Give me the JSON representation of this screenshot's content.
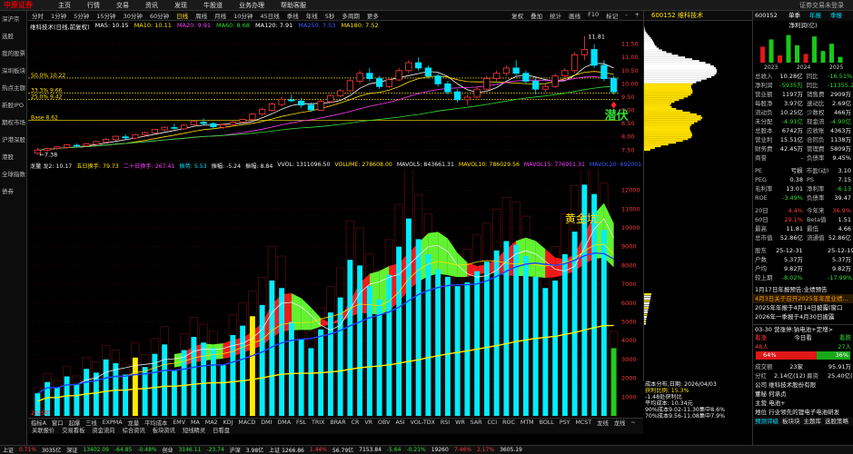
{
  "menubar": {
    "logo": "中原证券",
    "items": [
      "主页",
      "行情",
      "交易",
      "资讯",
      "发现",
      "牛股道",
      "业务办理",
      "帮助客服"
    ],
    "right_text": "证券交易未登录"
  },
  "sidebar": {
    "items": [
      "深沪京",
      "选股",
      "我的股票",
      "深圳板块",
      "热点主题",
      "新股IPO",
      "期权市场",
      "沪港深股",
      "港股",
      "全球指数",
      "债券"
    ]
  },
  "periodbar": {
    "items": [
      "分时",
      "1分钟",
      "5分钟",
      "15分钟",
      "30分钟",
      "60分钟",
      "日线",
      "周线",
      "月线",
      "10分钟",
      "45日线",
      "季线",
      "年线",
      "5秒",
      "多周期",
      "更多"
    ],
    "active": "日线",
    "right_items": [
      "复权",
      "叠加",
      "统计",
      "画线",
      "F10",
      "标记",
      "-",
      "+"
    ]
  },
  "stock": {
    "code": "600152",
    "name": "维科技术",
    "title_tag": "600152 维科技术"
  },
  "mainlegend": {
    "name": "维科技术(日线,前复权)",
    "ma": [
      {
        "label": "MA5: 10.15",
        "color": "#ffffff"
      },
      {
        "label": "MA10: 10.11",
        "color": "#ffe000"
      },
      {
        "label": "MA20: 9.91",
        "color": "#ff40ff"
      },
      {
        "label": "MA60: 8.68",
        "color": "#33dd33"
      },
      {
        "label": "MA120: 7.91",
        "color": "#ffffff"
      },
      {
        "label": "MA250: 7.53",
        "color": "#4060ff"
      },
      {
        "label": "MA180: 7.52",
        "color": "#ffe000"
      }
    ]
  },
  "price_levels": [
    {
      "label": "50.0% 10.22",
      "value": 10.22,
      "color": "#ffe000"
    },
    {
      "label": "33.3% 9.66",
      "value": 9.66,
      "color": "#ffe000"
    },
    {
      "label": "25.0% 9.42",
      "value": 9.42,
      "color": "#ffe000"
    },
    {
      "label": "Base 8.62",
      "value": 8.62,
      "color": "#ffe000"
    }
  ],
  "price_axis": [
    "11.50",
    "11.00",
    "10.50",
    "10.00",
    "9.50",
    "9.00",
    "8.50",
    "8.00",
    "7.50"
  ],
  "high_marker": "11.81",
  "low_marker": "7.38",
  "annotation_main": "潜伏",
  "volbar": {
    "items": [
      {
        "label": "龙量 龙2: 10.17",
        "color": "#eeeeee"
      },
      {
        "label": "五日换手: 79.73",
        "color": "#ffe000"
      },
      {
        "label": "二十日换手: 267.41",
        "color": "#ff40ff"
      },
      {
        "label": "振势: 5.53",
        "color": "#00e0ff"
      },
      {
        "label": "振幅: -5.24",
        "color": "#eeeeee"
      },
      {
        "label": "振幅: 8.84",
        "color": "#eeeeee"
      },
      {
        "label": "VVOL: 1311096.50",
        "color": "#eeeeee"
      },
      {
        "label": "VOLUME: 278608.00",
        "color": "#ffe000"
      },
      {
        "label": "MAVOL5: 843661.31",
        "color": "#eeeeee"
      },
      {
        "label": "MAVOL10: 786029.56",
        "color": "#ffe000"
      },
      {
        "label": "MAVOL15: 776951.31",
        "color": "#ff40ff"
      },
      {
        "label": "MAVOL20: 692001.06",
        "color": "#4060ff"
      }
    ]
  },
  "vol_axis": [
    "12000",
    "11000",
    "10000",
    "9000",
    "8000",
    "7000",
    "6000",
    "5000",
    "4000",
    "3000",
    "2000",
    "1000"
  ],
  "annotation_vol": "黄金坑",
  "date_label": "2025年",
  "indicator_tabs": [
    "指标A",
    "窗口",
    "起爆",
    "三线",
    "EXPMA",
    "龙量",
    "平均成本",
    "EMV",
    "MA",
    "MA2",
    "KDJ",
    "MACD",
    "DMI",
    "DMA",
    "FSL",
    "TRIX",
    "BRAR",
    "CR",
    "VR",
    "OBV",
    "ASI",
    "VOL-TDX",
    "RSI",
    "WR",
    "SAR",
    "CCI",
    "ROC",
    "MTM",
    "BOLL",
    "PSY",
    "MCST",
    "龙线",
    "龙线",
    "~"
  ],
  "info_tabs": [
    "关联报价",
    "交易看板",
    "资金流向",
    "综合资讯",
    "板块资讯",
    "短线精灵",
    "日看盘"
  ],
  "statusbar": [
    {
      "label": "上证",
      "color": "#eeeeee"
    },
    {
      "label": "0.71%",
      "color": "#ff3b3b"
    },
    {
      "label": "3035亿",
      "color": "#eeeeee"
    },
    {
      "label": "深证",
      "color": "#eeeeee"
    },
    {
      "label": "13402.09",
      "color": "#33dd33"
    },
    {
      "label": "-64.85",
      "color": "#33dd33"
    },
    {
      "label": "-0.48%",
      "color": "#33dd33"
    },
    {
      "label": "创业",
      "color": "#eeeeee"
    },
    {
      "label": "3146.11",
      "color": "#33dd33"
    },
    {
      "label": "-23.74",
      "color": "#33dd33"
    },
    {
      "label": "沪深",
      "color": "#eeeeee"
    },
    {
      "label": "3.98亿",
      "color": "#eeeeee"
    },
    {
      "label": "上证 1266.86",
      "color": "#eeeeee"
    },
    {
      "label": "1.44%",
      "color": "#ff3b3b"
    },
    {
      "label": "56.79亿",
      "color": "#eeeeee"
    },
    {
      "label": "7153.84",
      "color": "#eeeeee"
    },
    {
      "label": "-5.64",
      "color": "#33dd33"
    },
    {
      "label": "-0.21%",
      "color": "#33dd33"
    },
    {
      "label": "19260",
      "color": "#eeeeee"
    },
    {
      "label": "7:46%",
      "color": "#ff3b3b"
    },
    {
      "label": "2.17%",
      "color": "#ff3b3b"
    },
    {
      "label": "3605.19",
      "color": "#eeeeee"
    }
  ],
  "midtop": {
    "label": "600152 维科技术"
  },
  "rightpanel": {
    "head_code": "600152",
    "head_tabs": [
      "单季",
      "年报",
      "季报"
    ],
    "chart_title": "净利润(亿)",
    "chart_years": [
      "2023",
      "2024",
      "2025"
    ],
    "rows": [
      {
        "k": "总收入",
        "v": "10.28亿",
        "k2": "同比",
        "v2": "-16.51%",
        "c1": "#eeeeee",
        "c2": "#33dd33"
      },
      {
        "k": "净利润",
        "v": "-5935万",
        "k2": "同比",
        "v2": "-11355.24",
        "c1": "#33dd33",
        "c2": "#33dd33"
      },
      {
        "k": "营业额",
        "v": "1197万",
        "k2": "销售费",
        "v2": "2909万",
        "c1": "#eeeeee",
        "c2": "#eeeeee"
      },
      {
        "k": "每股净",
        "v": "3.97亿",
        "k2": "速动比",
        "v2": "2.69亿",
        "c1": "#eeeeee",
        "c2": "#eeeeee"
      },
      {
        "k": "流动负",
        "v": "10.25亿",
        "k2": "少数权",
        "v2": "466万",
        "c1": "#eeeeee",
        "c2": "#eeeeee"
      },
      {
        "k": "未分配",
        "v": "-4.91亿",
        "k2": "现金流",
        "v2": "-4.90亿",
        "c1": "#33dd33",
        "c2": "#33dd33"
      },
      {
        "k": "总股本",
        "v": "6742万",
        "k2": "应收账",
        "v2": "4363万",
        "c1": "#eeeeee",
        "c2": "#eeeeee"
      },
      {
        "k": "营业利",
        "v": "15.51亿",
        "k2": "合同负",
        "v2": "1138万",
        "c1": "#eeeeee",
        "c2": "#eeeeee"
      },
      {
        "k": "财务费",
        "v": "42.45万",
        "k2": "管理费",
        "v2": "5809万",
        "c1": "#eeeeee",
        "c2": "#eeeeee"
      },
      {
        "k": "商誉",
        "v": "-",
        "k2": "负债率",
        "v2": "9.45%",
        "c1": "#eeeeee",
        "c2": "#eeeeee"
      }
    ],
    "rows2": [
      {
        "k": "PE",
        "v": "亏损",
        "k2": "市盈(动)",
        "v2": "3.10",
        "c1": "#eeeeee",
        "c2": "#eeeeee"
      },
      {
        "k": "PEG",
        "v": "0.38",
        "k2": "PS",
        "v2": "7.15",
        "c1": "#eeeeee",
        "c2": "#eeeeee"
      },
      {
        "k": "毛利率",
        "v": "13.01",
        "k2": "净利率",
        "v2": "-6.13",
        "c1": "#eeeeee",
        "c2": "#33dd33"
      },
      {
        "k": "ROE",
        "v": "-3.49%",
        "k2": "负债率",
        "v2": "39.47",
        "c1": "#33dd33",
        "c2": "#eeeeee"
      }
    ],
    "rows3": [
      {
        "k": "20日",
        "v": "4.4%",
        "k2": "今年来",
        "v2": "36.9%",
        "c1": "#ff3b3b",
        "c2": "#ff3b3b"
      },
      {
        "k": "60日",
        "v": "29.1%",
        "k2": "Beta值",
        "v2": "1.51",
        "c1": "#ff3b3b",
        "c2": "#eeeeee"
      },
      {
        "k": "最高",
        "v": "11.81",
        "k2": "最低",
        "v2": "4.66",
        "c1": "#eeeeee",
        "c2": "#eeeeee"
      },
      {
        "k": "总市值",
        "v": "52.86亿",
        "k2": "流通值",
        "v2": "52.86亿",
        "c1": "#eeeeee",
        "c2": "#eeeeee"
      }
    ],
    "rows4": [
      {
        "k": "股东",
        "v": "25-12-31",
        "k2": "",
        "v2": "25-12-19",
        "c1": "#eeeeee",
        "c2": "#eeeeee"
      },
      {
        "k": "户数",
        "v": "5.37万",
        "k2": "",
        "v2": "5.37万",
        "c1": "#eeeeee",
        "c2": "#eeeeee"
      },
      {
        "k": "户均",
        "v": "9.82万",
        "k2": "",
        "v2": "9.82万",
        "c1": "#eeeeee",
        "c2": "#eeeeee"
      },
      {
        "k": "较上期",
        "v": "-8.02%",
        "k2": "",
        "v2": "-17.99%",
        "c1": "#33dd33",
        "c2": "#33dd33"
      }
    ],
    "news": [
      {
        "t": "1月17日年报预告:业绩预告",
        "c": "#eeeeee"
      },
      {
        "t": "4月3日关于召开2025年年度业绩...",
        "c": "#ff9a00"
      },
      {
        "t": "2025年年报于4月14日披露(窗口",
        "c": "#eeeeee"
      },
      {
        "t": "2026年一季报于4月30日披露",
        "c": "#eeeeee"
      }
    ],
    "notice": "03-30 营涨停:钠电池+定增>",
    "vote": {
      "label": "看涨",
      "mid": "今日看",
      "right": "看跌",
      "left_n": "48人",
      "right_n": "27人",
      "left_pct": "64%",
      "right_pct": "36%",
      "left_ratio": 0.64
    },
    "bottom_rows": [
      {
        "k": "成交额",
        "v": "23家",
        "k2": "",
        "v2": "95.91万",
        "c1": "#eeeeee",
        "c2": "#eeeeee"
      },
      {
        "k": "分红",
        "v": "2.14亿(12)",
        "k2": "募资",
        "v2": "25.40亿(12)",
        "c1": "#eeeeee",
        "c2": "#eeeeee"
      }
    ],
    "company": [
      {
        "t": "公司  维科技术股份有限",
        "c": "#eeeeee"
      },
      {
        "t": "董秘  何承贞",
        "c": "#eeeeee"
      },
      {
        "t": "主营  电池+",
        "c": "#eeeeee"
      },
      {
        "t": "地位  行业领先的锂电子电池研发",
        "c": "#eeeeee"
      }
    ],
    "bottom_tabs": [
      "预测评级",
      "板块块",
      "主题库",
      "选股策略"
    ]
  },
  "costinfo": {
    "lines": [
      "成本分布,日期: 2026/04/03",
      "获利比例:   15.3%",
      "-1.48处获利比",
      "平均成本: 10.34元",
      "90%成本9.02-11.30集中8.6%",
      "70%成本9.56-11.08集中7.9%"
    ]
  },
  "chart_data": {
    "type": "candlestick",
    "candles": [
      [
        7.38,
        7.58,
        7.32,
        7.5
      ],
      [
        7.5,
        7.6,
        7.42,
        7.56
      ],
      [
        7.56,
        7.65,
        7.5,
        7.62
      ],
      [
        7.6,
        7.72,
        7.55,
        7.7
      ],
      [
        7.68,
        7.75,
        7.6,
        7.66
      ],
      [
        7.66,
        7.78,
        7.62,
        7.74
      ],
      [
        7.72,
        7.85,
        7.68,
        7.82
      ],
      [
        7.8,
        7.95,
        7.76,
        7.9
      ],
      [
        7.9,
        8.05,
        7.85,
        8.02
      ],
      [
        8.0,
        8.1,
        7.9,
        7.96
      ],
      [
        7.95,
        8.12,
        7.9,
        8.08
      ],
      [
        8.08,
        8.2,
        8.02,
        8.16
      ],
      [
        8.15,
        8.3,
        8.1,
        8.28
      ],
      [
        8.26,
        8.4,
        8.2,
        8.36
      ],
      [
        8.35,
        8.5,
        8.28,
        8.32
      ],
      [
        8.3,
        8.48,
        8.26,
        8.44
      ],
      [
        8.45,
        8.62,
        8.4,
        8.58
      ],
      [
        8.55,
        8.7,
        8.45,
        8.5
      ],
      [
        8.5,
        8.55,
        8.3,
        8.38
      ],
      [
        8.36,
        8.5,
        8.3,
        8.46
      ],
      [
        8.46,
        8.6,
        8.4,
        8.56
      ],
      [
        8.55,
        8.7,
        8.5,
        8.66
      ],
      [
        8.65,
        8.9,
        8.6,
        8.86
      ],
      [
        8.86,
        9.1,
        8.8,
        9.04
      ],
      [
        9.0,
        9.3,
        8.96,
        9.24
      ],
      [
        9.22,
        9.5,
        9.15,
        9.42
      ],
      [
        9.4,
        9.6,
        9.3,
        9.36
      ],
      [
        9.35,
        9.45,
        9.1,
        9.2
      ],
      [
        9.2,
        9.3,
        8.95,
        9.02
      ],
      [
        9.0,
        9.4,
        8.98,
        9.34
      ],
      [
        9.32,
        9.6,
        9.3,
        9.56
      ],
      [
        9.55,
        9.8,
        9.5,
        9.74
      ],
      [
        9.74,
        10.2,
        9.7,
        10.12
      ],
      [
        10.1,
        10.5,
        10.0,
        10.4
      ],
      [
        10.4,
        10.6,
        10.1,
        10.2
      ],
      [
        10.2,
        10.3,
        9.8,
        9.9
      ],
      [
        9.9,
        10.2,
        9.85,
        10.16
      ],
      [
        10.15,
        10.6,
        10.1,
        10.5
      ],
      [
        10.5,
        10.9,
        10.4,
        10.8
      ],
      [
        10.8,
        11.0,
        10.5,
        10.6
      ],
      [
        10.6,
        10.7,
        10.2,
        10.3
      ],
      [
        10.3,
        10.4,
        9.9,
        10.0
      ],
      [
        10.0,
        10.1,
        9.6,
        9.7
      ],
      [
        9.7,
        9.8,
        9.3,
        9.4
      ],
      [
        9.4,
        9.6,
        9.2,
        9.5
      ],
      [
        9.5,
        9.9,
        9.45,
        9.8
      ],
      [
        9.8,
        10.3,
        9.75,
        10.2
      ],
      [
        10.2,
        10.5,
        10.1,
        10.4
      ],
      [
        10.4,
        10.7,
        10.3,
        10.6
      ],
      [
        10.6,
        10.9,
        10.3,
        10.4
      ],
      [
        10.4,
        10.5,
        10.0,
        10.1
      ],
      [
        10.1,
        10.2,
        9.6,
        9.8
      ],
      [
        9.8,
        10.0,
        9.7,
        9.9
      ],
      [
        9.9,
        10.4,
        9.85,
        10.3
      ],
      [
        10.3,
        10.6,
        10.2,
        10.5
      ],
      [
        10.5,
        11.2,
        10.4,
        11.1
      ],
      [
        11.1,
        11.81,
        10.9,
        11.3
      ],
      [
        11.3,
        11.5,
        10.6,
        10.7
      ],
      [
        10.7,
        10.9,
        10.1,
        10.2
      ],
      [
        10.2,
        10.3,
        9.6,
        9.7
      ]
    ],
    "volume_color_flags": [
      1,
      1,
      1,
      0,
      1,
      1,
      1,
      1,
      1,
      0,
      1,
      1,
      1,
      1,
      0,
      1,
      1,
      0,
      0,
      1,
      1,
      1,
      1,
      1,
      1,
      1,
      0,
      0,
      0,
      1,
      1,
      1,
      1,
      1,
      0,
      0,
      1,
      1,
      1,
      0,
      0,
      0,
      0,
      0,
      1,
      1,
      1,
      1,
      1,
      0,
      0,
      0,
      1,
      1,
      1,
      1,
      1,
      0,
      0,
      0
    ],
    "volumes": [
      1200,
      1800,
      1500,
      2100,
      1700,
      2500,
      2300,
      3000,
      2800,
      2200,
      3100,
      2600,
      3300,
      3800,
      2400,
      3500,
      4200,
      3900,
      3600,
      2700,
      4300,
      4800,
      5300,
      5900,
      7200,
      6800,
      5000,
      4100,
      3600,
      4600,
      5500,
      6300,
      8300,
      8000,
      6900,
      6200,
      7500,
      9000,
      10500,
      9400,
      8600,
      7800,
      7400,
      6900,
      7100,
      7700,
      8200,
      8800,
      9300,
      9100,
      8500,
      7400,
      6800,
      7200,
      8600,
      9800,
      12300,
      11800,
      9900,
      3600
    ],
    "ylim": [
      7.2,
      11.9
    ],
    "vol_ylim": [
      0,
      12800
    ]
  }
}
